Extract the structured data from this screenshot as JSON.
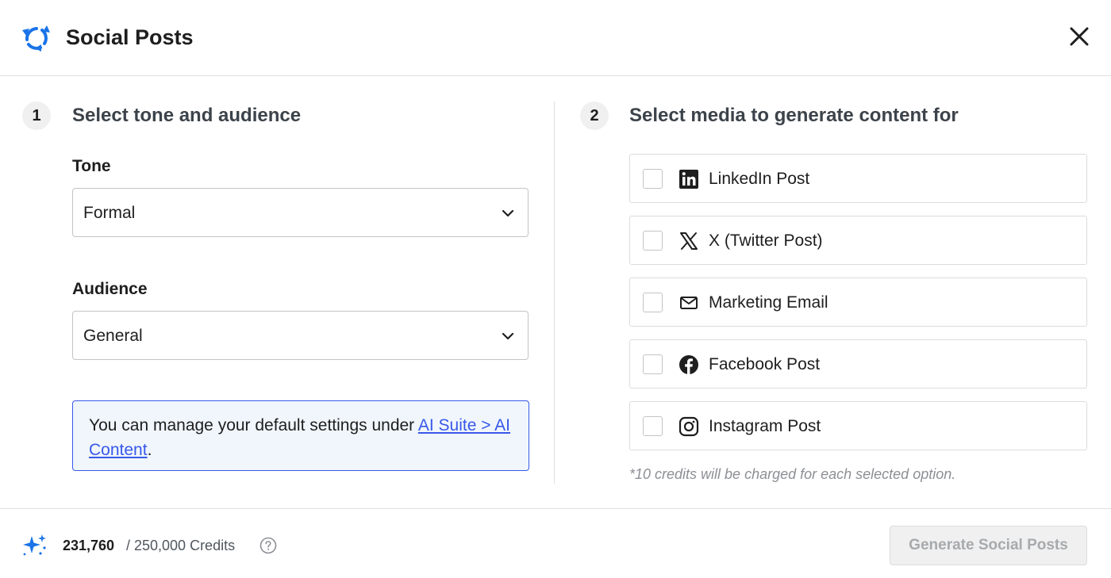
{
  "header": {
    "title": "Social Posts",
    "logo_icon": "refresh-cycle-icon",
    "close_icon": "close-icon",
    "accent_color": "#1a73e8"
  },
  "step1": {
    "number": "1",
    "title": "Select tone and audience",
    "tone": {
      "label": "Tone",
      "value": "Formal"
    },
    "audience": {
      "label": "Audience",
      "value": "General"
    },
    "notice": {
      "text": "You can manage your default settings under ",
      "link": "AI Suite > AI Content",
      "suffix": "."
    }
  },
  "step2": {
    "number": "2",
    "title": "Select media to generate content for",
    "media": [
      {
        "label": "LinkedIn Post",
        "icon": "linkedin-icon",
        "checked": false
      },
      {
        "label": "X (Twitter Post)",
        "icon": "x-twitter-icon",
        "checked": false
      },
      {
        "label": "Marketing Email",
        "icon": "envelope-icon",
        "checked": false
      },
      {
        "label": "Facebook Post",
        "icon": "facebook-icon",
        "checked": false
      },
      {
        "label": "Instagram Post",
        "icon": "instagram-icon",
        "checked": false
      }
    ],
    "note": "*10 credits will be charged for each selected option."
  },
  "footer": {
    "credits_used": "231,760",
    "credits_total": "/ 250,000 Credits",
    "generate_label": "Generate Social Posts",
    "generate_disabled": true
  }
}
